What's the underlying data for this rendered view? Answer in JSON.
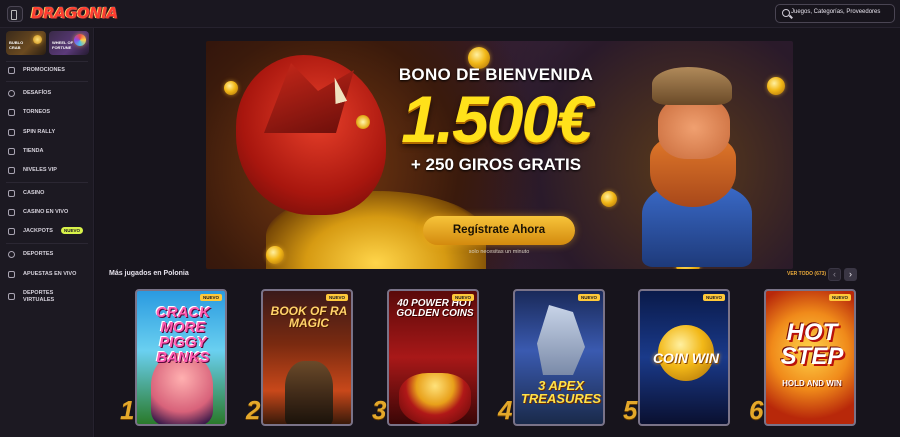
{
  "header": {
    "logo_text": "DRAGONIA",
    "search_placeholder": "Juegos, Categorías, Proveedores",
    "menu_icon": "sidebar-toggle-icon"
  },
  "sidebar": {
    "featured": [
      {
        "label": "BUBLO CRAB"
      },
      {
        "label": "WHEEL OF FORTUNE"
      }
    ],
    "items": [
      {
        "label": "PROMOCIONES",
        "icon": "gift-icon"
      },
      {
        "label": "DESAFÍOS",
        "icon": "target-icon"
      },
      {
        "label": "TORNEOS",
        "icon": "trophy-icon"
      },
      {
        "label": "SPIN RALLY",
        "icon": "flag-icon"
      },
      {
        "label": "TIENDA",
        "icon": "cart-icon"
      },
      {
        "label": "NIVELES VIP",
        "icon": "crown-icon"
      },
      {
        "label": "CASINO",
        "icon": "slot-icon"
      },
      {
        "label": "CASINO EN VIVO",
        "icon": "live-icon"
      },
      {
        "label": "JACKPOTS",
        "icon": "jackpot-icon",
        "badge": "NUEVO"
      },
      {
        "label": "DEPORTES",
        "icon": "ball-icon"
      },
      {
        "label": "APUESTAS EN VIVO",
        "icon": "live-bet-icon"
      },
      {
        "label": "DEPORTES VIRTUALES",
        "icon": "virtual-sports-icon"
      }
    ],
    "badge_color": "#d8f24a"
  },
  "banner": {
    "line1": "BONO DE BIENVENIDA",
    "amount": "1.500€",
    "line3": "+ 250 GIROS GRATIS",
    "cta": "Regístrate Ahora",
    "cta_sub": "solo necesitas un minuto"
  },
  "section": {
    "title": "Más jugados en Polonia",
    "see_all": "VER TODO (673)",
    "prev_icon": "chevron-left-icon",
    "next_icon": "chevron-right-icon"
  },
  "games": [
    {
      "rank": "1",
      "title": "CRACK MORE PIGGY BANKS",
      "badge": "NUEVO"
    },
    {
      "rank": "2",
      "title": "BOOK OF RA MAGIC",
      "badge": "NUEVO"
    },
    {
      "rank": "3",
      "title": "40 POWER HOT GOLDEN COINS",
      "badge": "NUEVO"
    },
    {
      "rank": "4",
      "title": "3 APEX TREASURES",
      "badge": "NUEVO"
    },
    {
      "rank": "5",
      "title": "COIN WIN",
      "badge": "NUEVO"
    },
    {
      "rank": "6",
      "title": "HOT STEP",
      "subtitle": "HOLD AND WIN",
      "badge": "NUEVO"
    }
  ],
  "colors": {
    "accent": "#ffc93a",
    "cta": "#f2b818",
    "background": "#17141c"
  }
}
